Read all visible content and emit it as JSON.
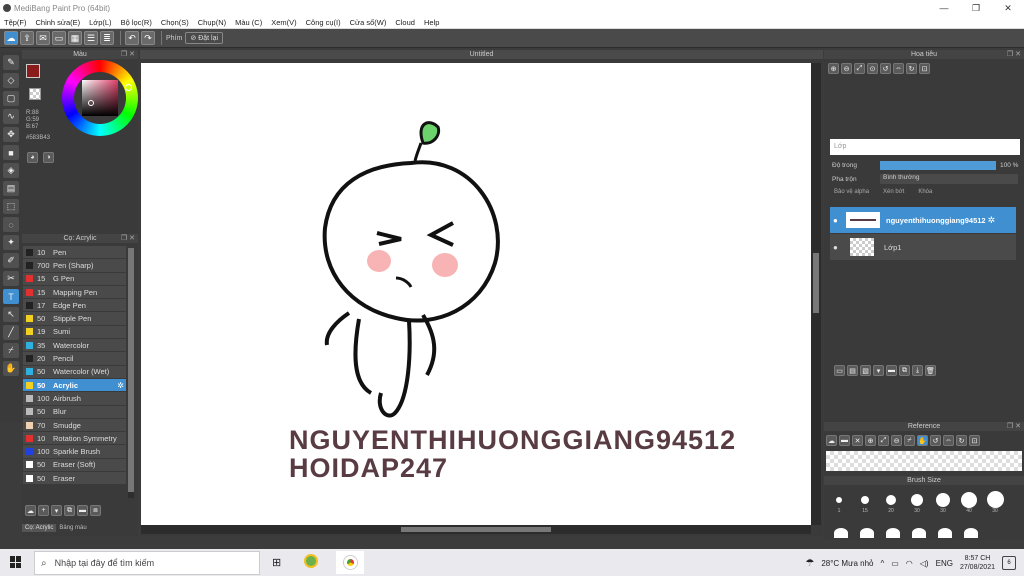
{
  "window": {
    "title": "MediBang Paint Pro (64bit)",
    "controls": [
      "—",
      "❐",
      "✕"
    ]
  },
  "menu": [
    "Tệp(F)",
    "Chỉnh sửa(E)",
    "Lớp(L)",
    "Bộ lọc(R)",
    "Chọn(S)",
    "Chụp(N)",
    "Màu (C)",
    "Xem(V)",
    "Công cụ(I)",
    "Cửa sổ(W)",
    "Cloud",
    "Help"
  ],
  "toolbar": {
    "phim_label": "Phím",
    "reset_label": "Đặt lại"
  },
  "color_panel": {
    "title": "Màu",
    "r": "R:88",
    "g": "G:59",
    "b": "B:67",
    "hex": "#583B43",
    "primary_color": "#583b43"
  },
  "brush_panel": {
    "title": "Cọ: Acrylic",
    "brushes": [
      {
        "size": "10",
        "name": "Pen",
        "color": "#222222"
      },
      {
        "size": "700",
        "name": "Pen (Sharp)",
        "color": "#222222"
      },
      {
        "size": "15",
        "name": "G Pen",
        "color": "#e03030"
      },
      {
        "size": "15",
        "name": "Mapping Pen",
        "color": "#e03030"
      },
      {
        "size": "17",
        "name": "Edge Pen",
        "color": "#222222"
      },
      {
        "size": "50",
        "name": "Stipple Pen",
        "color": "#f0d020"
      },
      {
        "size": "19",
        "name": "Sumi",
        "color": "#f0d020"
      },
      {
        "size": "35",
        "name": "Watercolor",
        "color": "#30b0e0"
      },
      {
        "size": "20",
        "name": "Pencil",
        "color": "#222222"
      },
      {
        "size": "50",
        "name": "Watercolor (Wet)",
        "color": "#30b0e0"
      },
      {
        "size": "50",
        "name": "Acrylic",
        "color": "#f0d020"
      },
      {
        "size": "100",
        "name": "Airbrush",
        "color": "#bbbbbb"
      },
      {
        "size": "50",
        "name": "Blur",
        "color": "#bbbbbb"
      },
      {
        "size": "70",
        "name": "Smudge",
        "color": "#f0d0b0"
      },
      {
        "size": "10",
        "name": "Rotation Symmetry",
        "color": "#e03030"
      },
      {
        "size": "100",
        "name": "Sparkle Brush",
        "color": "#2040e0"
      },
      {
        "size": "50",
        "name": "Eraser (Soft)",
        "color": "#ffffff"
      },
      {
        "size": "50",
        "name": "Eraser",
        "color": "#ffffff"
      }
    ],
    "selected": "Acrylic",
    "tabs": [
      "Cọ: Acrylic",
      "Bảng màu"
    ]
  },
  "canvas": {
    "tab_title": "Untitled",
    "line1": "NGUYENTHIHUONGGIANG94512",
    "line2": "HOIDAP247"
  },
  "navigator": {
    "title": "Hoa tiêu"
  },
  "layers": {
    "title": "Lớp",
    "opacity_label": "Độ trong",
    "opacity_value": "100 %",
    "blend_label": "Pha trộn",
    "blend_value": "Bình thường",
    "protect_alpha": "Bảo vệ alpha",
    "clipping": "Xén bớt",
    "lock": "Khóa",
    "items": [
      {
        "name": "nguyenthihuonggiang94512",
        "selected": true
      },
      {
        "name": "Lớp1",
        "selected": false
      }
    ]
  },
  "reference": {
    "title": "Reference"
  },
  "brush_size": {
    "title": "Brush Size",
    "sizes": [
      "1",
      "15",
      "20",
      "30",
      "30",
      "40",
      "30"
    ]
  },
  "taskbar": {
    "search_placeholder": "Nhập tại đây để tìm kiếm",
    "weather": "28°C  Mưa nhỏ",
    "lang": "ENG",
    "time": "8:57 CH",
    "date": "27/08/2021",
    "notif": "6"
  }
}
